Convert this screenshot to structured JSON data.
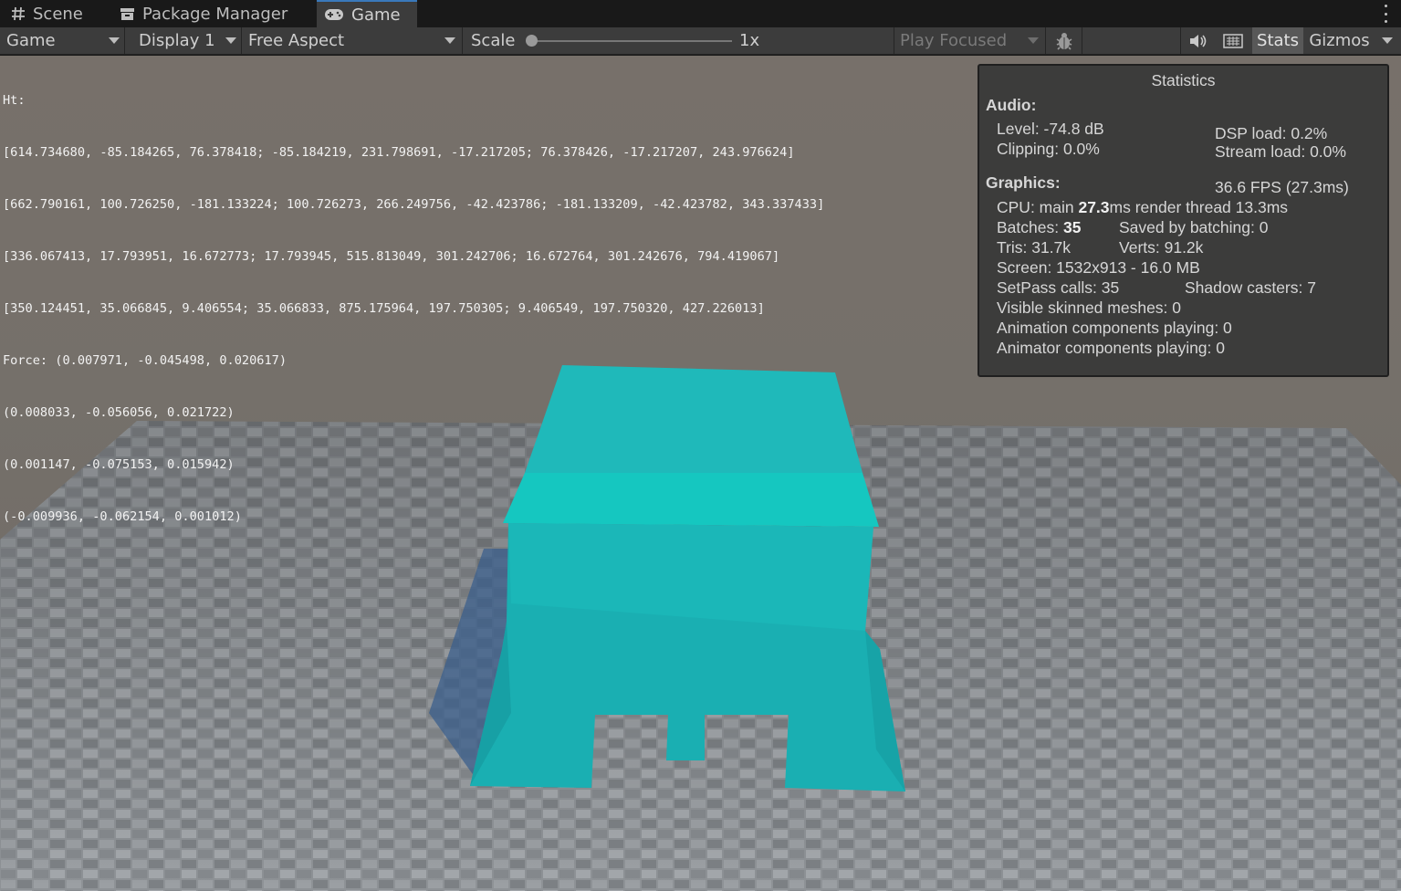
{
  "tabs": [
    {
      "label": "Scene",
      "icon": "grid-hash-icon"
    },
    {
      "label": "Package Manager",
      "icon": "package-icon"
    },
    {
      "label": "Game",
      "icon": "gamepad-icon",
      "active": true
    }
  ],
  "toolbar": {
    "game_view_select": "Game",
    "display_select": "Display 1",
    "aspect_select": "Free Aspect",
    "scale_label": "Scale",
    "scale_value": "1x",
    "scale_level": 0,
    "play_mode_select": "Play Focused",
    "stats_label": "Stats",
    "gizmos_label": "Gizmos",
    "icons": [
      "bug-icon",
      "speaker-icon",
      "keyboard-icon"
    ]
  },
  "debug_text": {
    "lines": [
      "Ht:",
      "[614.734680, -85.184265, 76.378418; -85.184219, 231.798691, -17.217205; 76.378426, -17.217207, 243.976624]",
      "[662.790161, 100.726250, -181.133224; 100.726273, 266.249756, -42.423786; -181.133209, -42.423782, 343.337433]",
      "[336.067413, 17.793951, 16.672773; 17.793945, 515.813049, 301.242706; 16.672764, 301.242676, 794.419067]",
      "[350.124451, 35.066845, 9.406554; 35.066833, 875.175964, 197.750305; 9.406549, 197.750320, 427.226013]",
      "Force: (0.007971, -0.045498, 0.020617)",
      "(0.008033, -0.056056, 0.021722)",
      "(0.001147, -0.075153, 0.015942)",
      "(-0.009936, -0.062154, 0.001012)"
    ]
  },
  "statistics": {
    "title": "Statistics",
    "audio_header": "Audio:",
    "level": "Level: -74.8 dB",
    "clipping": "Clipping: 0.0%",
    "dsp_load": "DSP load: 0.2%",
    "stream_load": "Stream load: 0.0%",
    "graphics_header": "Graphics:",
    "fps": "36.6 FPS (27.3ms)",
    "cpu_prefix": "CPU: main ",
    "cpu_main_value": "27.3",
    "cpu_suffix": "ms  render thread 13.3ms",
    "batches_prefix": "Batches: ",
    "batches_value": "35",
    "saved_by_batching": "Saved by batching: 0",
    "tris": "Tris: 31.7k",
    "verts": "Verts: 91.2k",
    "screen": "Screen: 1532x913 - 16.0 MB",
    "setpass": "SetPass calls: 35",
    "shadow_casters": "Shadow casters: 7",
    "visible_skinned": "Visible skinned meshes: 0",
    "animation_components": "Animation components playing: 0",
    "animator_components": "Animator components playing: 0"
  },
  "scene": {
    "object_color": "#1ab8b8",
    "floor_color": "#8f9397",
    "background_color": "#76706a"
  }
}
